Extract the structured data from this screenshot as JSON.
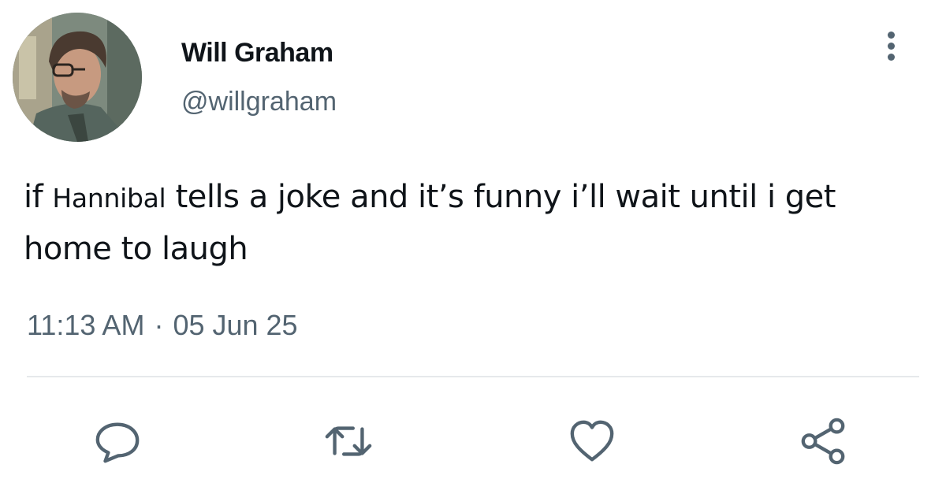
{
  "tweet": {
    "author": {
      "display_name": "Will Graham",
      "handle": "@willgraham",
      "avatar_icon": "profile-photo"
    },
    "text": {
      "before": "if ",
      "mention": "Hannibal",
      "after": " tells a joke and it’s funny i’ll wait until i get home to laugh"
    },
    "time": "11:13 AM",
    "separator": "·",
    "date": "05 Jun 25",
    "actions": [
      {
        "name": "reply",
        "icon": "speech-bubble-icon"
      },
      {
        "name": "retweet",
        "icon": "retweet-arrows-icon"
      },
      {
        "name": "like",
        "icon": "heart-icon"
      },
      {
        "name": "share",
        "icon": "share-nodes-icon"
      }
    ],
    "colors": {
      "text_primary": "#0f1419",
      "text_secondary": "#536471",
      "divider": "#e6e9eb",
      "background": "#ffffff"
    }
  }
}
